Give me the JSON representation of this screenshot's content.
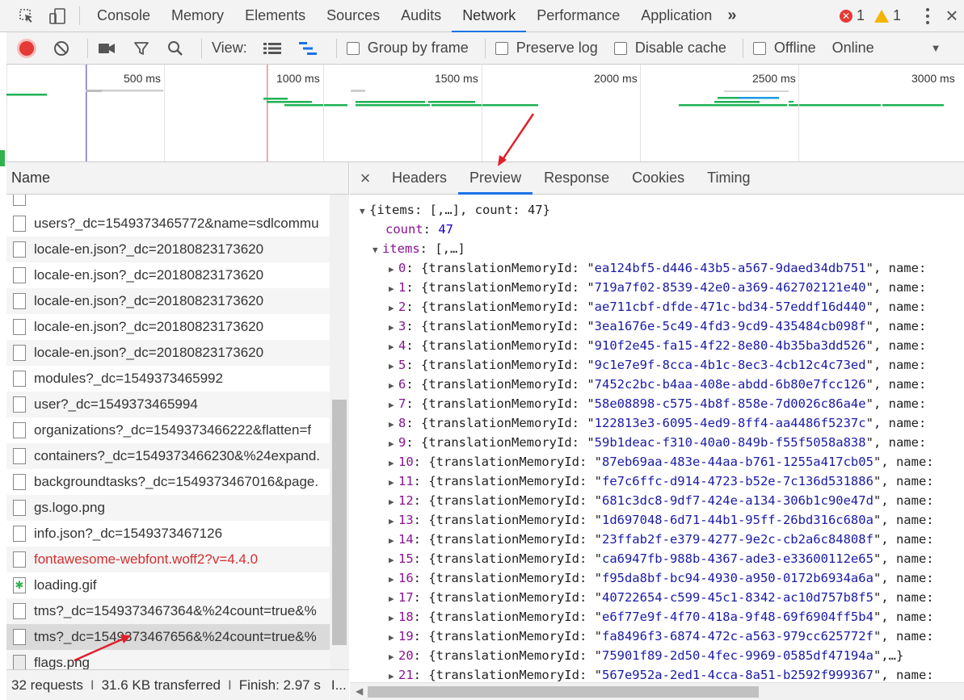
{
  "devtools": {
    "tabs": [
      "Console",
      "Memory",
      "Elements",
      "Sources",
      "Audits",
      "Network",
      "Performance",
      "Application"
    ],
    "active_tab": "Network",
    "more_label": "»",
    "error_count": "1",
    "warning_count": "1",
    "close_label": "×"
  },
  "toolbar": {
    "view_label": "View:",
    "group_by_frame": "Group by frame",
    "preserve_log": "Preserve log",
    "disable_cache": "Disable cache",
    "offline": "Offline",
    "throttle": "Online"
  },
  "overview": {
    "ticks": [
      "500 ms",
      "1000 ms",
      "1500 ms",
      "2000 ms",
      "2500 ms",
      "3000 ms"
    ]
  },
  "requests": {
    "column_header": "Name",
    "items": [
      {
        "name": "users?_dc=1549373465772&name=sdlcommu",
        "icon": "file",
        "error": false
      },
      {
        "name": "locale-en.json?_dc=20180823173620",
        "icon": "file",
        "error": false
      },
      {
        "name": "locale-en.json?_dc=20180823173620",
        "icon": "file",
        "error": false
      },
      {
        "name": "locale-en.json?_dc=20180823173620",
        "icon": "file",
        "error": false
      },
      {
        "name": "locale-en.json?_dc=20180823173620",
        "icon": "file",
        "error": false
      },
      {
        "name": "locale-en.json?_dc=20180823173620",
        "icon": "file",
        "error": false
      },
      {
        "name": "modules?_dc=1549373465992",
        "icon": "file",
        "error": false
      },
      {
        "name": "user?_dc=1549373465994",
        "icon": "file",
        "error": false
      },
      {
        "name": "organizations?_dc=1549373466222&flatten=f",
        "icon": "file",
        "error": false
      },
      {
        "name": "containers?_dc=1549373466230&%24expand.",
        "icon": "file",
        "error": false
      },
      {
        "name": "backgroundtasks?_dc=1549373467016&page.",
        "icon": "file",
        "error": false
      },
      {
        "name": "gs.logo.png",
        "icon": "file",
        "error": false
      },
      {
        "name": "info.json?_dc=1549373467126",
        "icon": "file",
        "error": false
      },
      {
        "name": "fontawesome-webfont.woff2?v=4.4.0",
        "icon": "file",
        "error": true
      },
      {
        "name": "loading.gif",
        "icon": "gif",
        "error": false
      },
      {
        "name": "tms?_dc=1549373467364&%24count=true&%",
        "icon": "file",
        "error": false
      },
      {
        "name": "tms?_dc=1549373467656&%24count=true&%",
        "icon": "file",
        "error": false,
        "selected": true
      },
      {
        "name": "flags.png",
        "icon": "image",
        "error": false
      }
    ],
    "status": {
      "requests": "32 requests",
      "transferred": "31.6 KB transferred",
      "finish": "Finish: 2.97 s",
      "more": "I..."
    }
  },
  "detail": {
    "close_label": "×",
    "tabs": [
      "Headers",
      "Preview",
      "Response",
      "Cookies",
      "Timing"
    ],
    "active_tab": "Preview",
    "preview": {
      "root_summary": "{items: [,…], count: 47}",
      "count_key": "count",
      "count_value": "47",
      "items_key": "items",
      "items_summary": "[,…]",
      "entries": [
        {
          "index": "0",
          "id": "ea124bf5-d446-43b5-a567-9daed34db751",
          "tail": ", name:"
        },
        {
          "index": "1",
          "id": "719a7f02-8539-42e0-a369-462702121e40",
          "tail": ", name:"
        },
        {
          "index": "2",
          "id": "ae711cbf-dfde-471c-bd34-57eddf16d440",
          "tail": ", name:"
        },
        {
          "index": "3",
          "id": "3ea1676e-5c49-4fd3-9cd9-435484cb098f",
          "tail": ", name:"
        },
        {
          "index": "4",
          "id": "910f2e45-fa15-4f22-8e80-4b35ba3dd526",
          "tail": ", name:"
        },
        {
          "index": "5",
          "id": "9c1e7e9f-8cca-4b1c-8ec3-4cb12c4c73ed",
          "tail": ", name:"
        },
        {
          "index": "6",
          "id": "7452c2bc-b4aa-408e-abdd-6b80e7fcc126",
          "tail": ", name:"
        },
        {
          "index": "7",
          "id": "58e08898-c575-4b8f-858e-7d0026c86a4e",
          "tail": ", name:"
        },
        {
          "index": "8",
          "id": "122813e3-6095-4ed9-8ff4-aa4486f5237c",
          "tail": ", name:"
        },
        {
          "index": "9",
          "id": "59b1deac-f310-40a0-849b-f55f5058a838",
          "tail": ", name:"
        },
        {
          "index": "10",
          "id": "87eb69aa-483e-44aa-b761-1255a417cb05",
          "tail": ", name:"
        },
        {
          "index": "11",
          "id": "fe7c6ffc-d914-4723-b52e-7c136d531886",
          "tail": ", name:"
        },
        {
          "index": "12",
          "id": "681c3dc8-9df7-424e-a134-306b1c90e47d",
          "tail": ", name:"
        },
        {
          "index": "13",
          "id": "1d697048-6d71-44b1-95ff-26bd316c680a",
          "tail": ", name:"
        },
        {
          "index": "14",
          "id": "23ffab2f-e379-4277-9e2c-cb2a6c84808f",
          "tail": ", name:"
        },
        {
          "index": "15",
          "id": "ca6947fb-988b-4367-ade3-e33600112e65",
          "tail": ", name:"
        },
        {
          "index": "16",
          "id": "f95da8bf-bc94-4930-a950-0172b6934a6a",
          "tail": ", name:"
        },
        {
          "index": "17",
          "id": "40722654-c599-45c1-8342-ac10d757b8f5",
          "tail": ", name:"
        },
        {
          "index": "18",
          "id": "e6f77e9f-4f70-418a-9f48-69f6904ff5b4",
          "tail": ", name:"
        },
        {
          "index": "19",
          "id": "fa8496f3-6874-472c-a563-979cc625772f",
          "tail": ", name:"
        },
        {
          "index": "20",
          "id": "75901f89-2d50-4fec-9969-0585df47194a",
          "tail": ",…}"
        },
        {
          "index": "21",
          "id": "567e952a-2ed1-4cca-8a51-b2592f999367",
          "tail": ", name:"
        }
      ],
      "entry_key": "translationMemoryId"
    }
  },
  "colors": {
    "record": "#e53935",
    "accent": "#1a73e8",
    "waterfall_green": "#1fb254",
    "waterfall_blue": "#1a9ae0",
    "error_text": "#d32f2f",
    "annotation_arrow": "#e0202a"
  }
}
